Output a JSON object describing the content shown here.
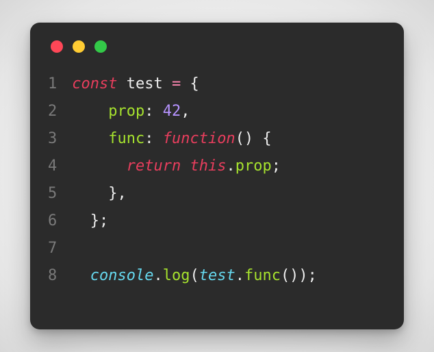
{
  "window": {
    "traffic": {
      "red": "#ff4757",
      "yellow": "#ffcc33",
      "green": "#33c948"
    }
  },
  "code": {
    "language": "javascript",
    "lines": [
      {
        "n": "1",
        "tokens": [
          {
            "cls": "kw",
            "t": "const"
          },
          {
            "cls": "ident",
            "t": " test "
          },
          {
            "cls": "op",
            "t": "="
          },
          {
            "cls": "punct",
            "t": " {"
          }
        ]
      },
      {
        "n": "2",
        "tokens": [
          {
            "cls": "punct",
            "t": "    "
          },
          {
            "cls": "prop",
            "t": "prop"
          },
          {
            "cls": "punct",
            "t": ": "
          },
          {
            "cls": "num",
            "t": "42"
          },
          {
            "cls": "punct",
            "t": ","
          }
        ]
      },
      {
        "n": "3",
        "tokens": [
          {
            "cls": "punct",
            "t": "    "
          },
          {
            "cls": "prop",
            "t": "func"
          },
          {
            "cls": "punct",
            "t": ": "
          },
          {
            "cls": "kw",
            "t": "function"
          },
          {
            "cls": "punct",
            "t": "() {"
          }
        ]
      },
      {
        "n": "4",
        "tokens": [
          {
            "cls": "punct",
            "t": "      "
          },
          {
            "cls": "kw",
            "t": "return"
          },
          {
            "cls": "ident",
            "t": " "
          },
          {
            "cls": "kw",
            "t": "this"
          },
          {
            "cls": "punct",
            "t": "."
          },
          {
            "cls": "prop",
            "t": "prop"
          },
          {
            "cls": "punct",
            "t": ";"
          }
        ]
      },
      {
        "n": "5",
        "tokens": [
          {
            "cls": "punct",
            "t": "    },"
          }
        ]
      },
      {
        "n": "6",
        "tokens": [
          {
            "cls": "punct",
            "t": "  };"
          }
        ]
      },
      {
        "n": "7",
        "tokens": [
          {
            "cls": "punct",
            "t": ""
          }
        ]
      },
      {
        "n": "8",
        "tokens": [
          {
            "cls": "punct",
            "t": "  "
          },
          {
            "cls": "obj",
            "t": "console"
          },
          {
            "cls": "punct",
            "t": "."
          },
          {
            "cls": "prop",
            "t": "log"
          },
          {
            "cls": "punct",
            "t": "("
          },
          {
            "cls": "obj",
            "t": "test"
          },
          {
            "cls": "punct",
            "t": "."
          },
          {
            "cls": "prop",
            "t": "func"
          },
          {
            "cls": "punct",
            "t": "());"
          }
        ]
      }
    ]
  }
}
